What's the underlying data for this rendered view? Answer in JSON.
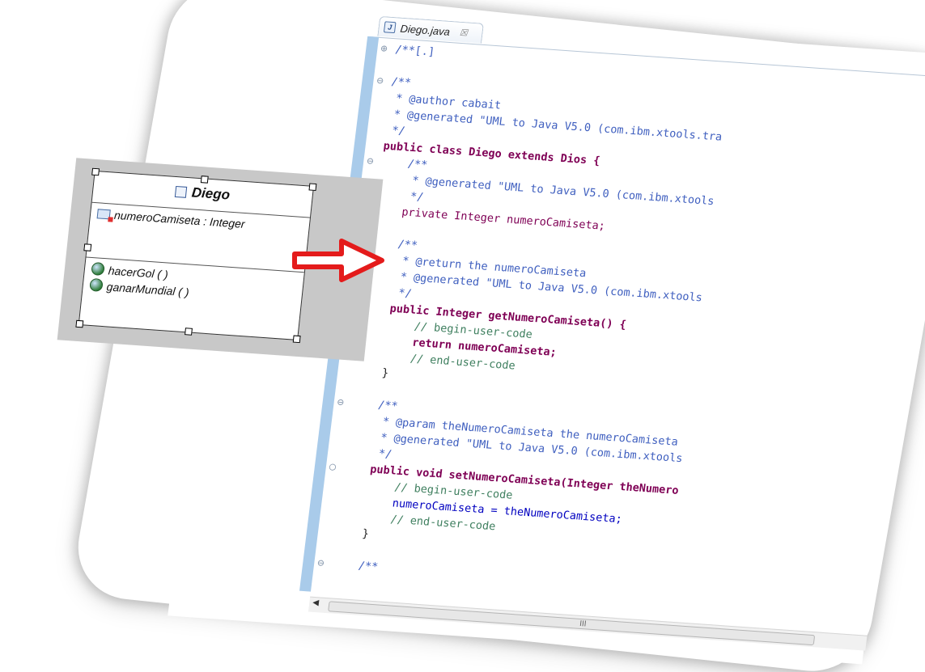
{
  "editor": {
    "tab_title": "Diego.java",
    "tab_close": "☒",
    "scroll_grip": "III",
    "scroll_left": "◀",
    "lines": [
      {
        "fold": "⊕",
        "text": "/**[.]",
        "cls": "jd"
      },
      {
        "fold": "",
        "text": "",
        "cls": "jd"
      },
      {
        "fold": "⊖",
        "text": "/**",
        "cls": "jd"
      },
      {
        "fold": "",
        "text": " * @author cabait",
        "cls": "jd"
      },
      {
        "fold": "",
        "text": " * @generated \"UML to Java V5.0 (com.ibm.xtools.tra",
        "cls": "jd"
      },
      {
        "fold": "",
        "text": " */",
        "cls": "jd"
      },
      {
        "fold": "",
        "text": "public class Diego extends Dios {",
        "cls": "kwline"
      },
      {
        "fold": "⊖",
        "text": "    /**",
        "cls": "jd"
      },
      {
        "fold": "",
        "text": "     * @generated \"UML to Java V5.0 (com.ibm.xtools",
        "cls": "jd"
      },
      {
        "fold": "",
        "text": "     */",
        "cls": "jd"
      },
      {
        "fold": "",
        "text": "    private Integer numeroCamiseta;",
        "cls": "field"
      },
      {
        "fold": "",
        "text": "",
        "cls": "jd"
      },
      {
        "fold": "",
        "text": "    /**",
        "cls": "jd"
      },
      {
        "fold": "",
        "text": "     * @return the numeroCamiseta",
        "cls": "jd"
      },
      {
        "fold": "",
        "text": "     * @generated \"UML to Java V5.0 (com.ibm.xtools",
        "cls": "jd"
      },
      {
        "fold": "",
        "text": "     */",
        "cls": "jd"
      },
      {
        "fold": "",
        "text": "    public Integer getNumeroCamiseta() {",
        "cls": "method"
      },
      {
        "fold": "",
        "text": "        // begin-user-code",
        "cls": "cm"
      },
      {
        "fold": "",
        "text": "        return numeroCamiseta;",
        "cls": "ret"
      },
      {
        "fold": "",
        "text": "        // end-user-code",
        "cls": "cm"
      },
      {
        "fold": "",
        "text": "    }",
        "cls": "plain"
      },
      {
        "fold": "",
        "text": "",
        "cls": "jd"
      },
      {
        "fold": "⊖",
        "text": "    /**",
        "cls": "jd"
      },
      {
        "fold": "",
        "text": "     * @param theNumeroCamiseta the numeroCamiseta",
        "cls": "jd"
      },
      {
        "fold": "",
        "text": "     * @generated \"UML to Java V5.0 (com.ibm.xtools",
        "cls": "jd"
      },
      {
        "fold": "",
        "text": "     */",
        "cls": "jd"
      },
      {
        "fold": "○",
        "text": "    public void setNumeroCamiseta(Integer theNumero",
        "cls": "method"
      },
      {
        "fold": "",
        "text": "        // begin-user-code",
        "cls": "cm"
      },
      {
        "fold": "",
        "text": "        numeroCamiseta = theNumeroCamiseta;",
        "cls": "assign"
      },
      {
        "fold": "",
        "text": "        // end-user-code",
        "cls": "cm"
      },
      {
        "fold": "",
        "text": "    }",
        "cls": "plain"
      },
      {
        "fold": "",
        "text": "",
        "cls": "jd"
      },
      {
        "fold": "⊖",
        "text": "    /**",
        "cls": "jd"
      }
    ]
  },
  "uml": {
    "class_name": "Diego",
    "attributes": [
      "numeroCamiseta : Integer"
    ],
    "operations": [
      "hacerGol ( )",
      "ganarMundial ( )"
    ]
  },
  "colors": {
    "keyword": "#7f0055",
    "javadoc": "#3f5fbf",
    "comment": "#3f7f5f",
    "field": "#0000c0",
    "arrow": "#e41b1b",
    "ruler": "#a9cbea"
  }
}
